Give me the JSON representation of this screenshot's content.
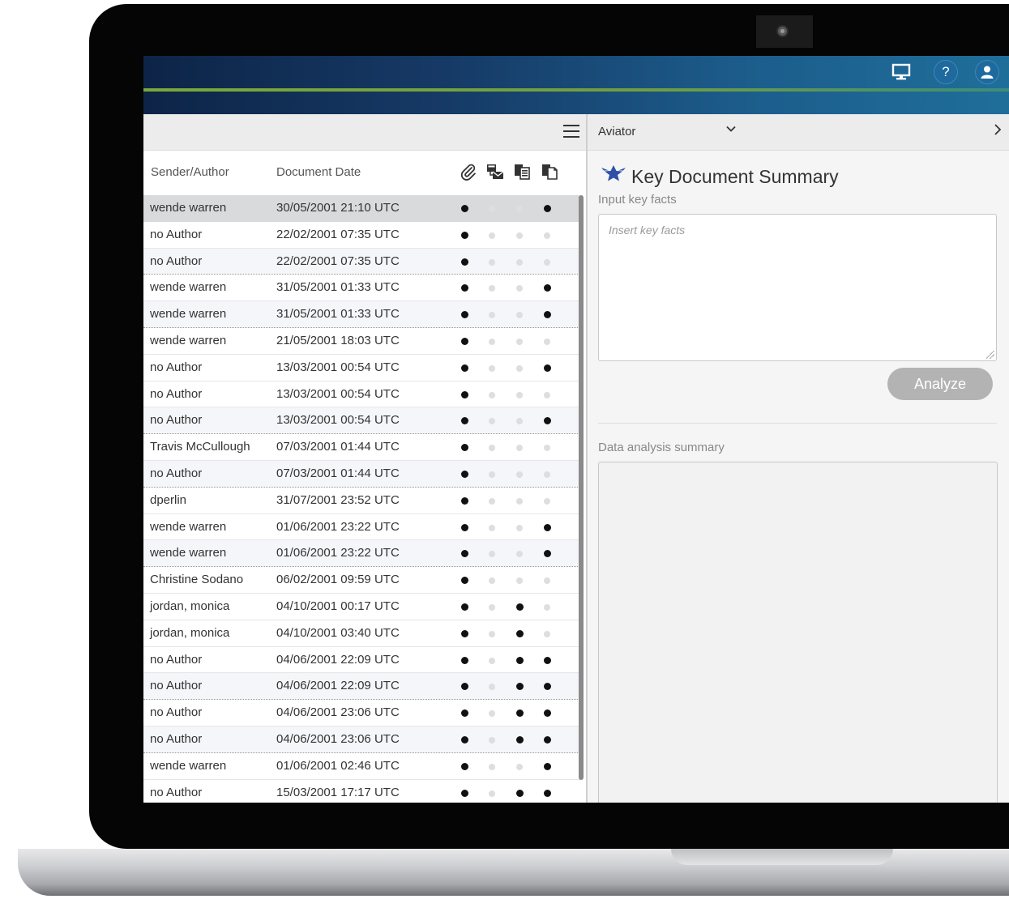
{
  "header": {
    "icons": [
      "monitor-icon",
      "help-icon",
      "user-icon"
    ],
    "help_glyph": "?"
  },
  "left_panel": {
    "columns": {
      "sender": "Sender/Author",
      "date": "Document Date",
      "icon_columns": [
        "paperclip-icon",
        "email-icon",
        "duplicate-docs-icon",
        "copy-docs-icon"
      ]
    },
    "rows": [
      {
        "sender": "wende warren",
        "date": "30/05/2001 21:10 UTC",
        "flags": [
          1,
          0,
          0,
          1
        ],
        "selected": true
      },
      {
        "sender": "no Author",
        "date": "22/02/2001 07:35 UTC",
        "flags": [
          1,
          0,
          0,
          0
        ]
      },
      {
        "sender": "no Author",
        "date": "22/02/2001 07:35 UTC",
        "flags": [
          1,
          0,
          0,
          0
        ]
      },
      {
        "sender": "wende warren",
        "date": "31/05/2001 01:33 UTC",
        "flags": [
          1,
          0,
          0,
          1
        ]
      },
      {
        "sender": "wende warren",
        "date": "31/05/2001 01:33 UTC",
        "flags": [
          1,
          0,
          0,
          1
        ]
      },
      {
        "sender": "wende warren",
        "date": "21/05/2001 18:03 UTC",
        "flags": [
          1,
          0,
          0,
          0
        ]
      },
      {
        "sender": "no Author",
        "date": "13/03/2001 00:54 UTC",
        "flags": [
          1,
          0,
          0,
          1
        ]
      },
      {
        "sender": "no Author",
        "date": "13/03/2001 00:54 UTC",
        "flags": [
          1,
          0,
          0,
          0
        ]
      },
      {
        "sender": "no Author",
        "date": "13/03/2001 00:54 UTC",
        "flags": [
          1,
          0,
          0,
          1
        ]
      },
      {
        "sender": "Travis McCullough",
        "date": "07/03/2001 01:44 UTC",
        "flags": [
          1,
          0,
          0,
          0
        ]
      },
      {
        "sender": "no Author",
        "date": "07/03/2001 01:44 UTC",
        "flags": [
          1,
          0,
          0,
          0
        ]
      },
      {
        "sender": "dperlin",
        "date": "31/07/2001 23:52 UTC",
        "flags": [
          1,
          0,
          0,
          0
        ]
      },
      {
        "sender": "wende warren",
        "date": "01/06/2001 23:22 UTC",
        "flags": [
          1,
          0,
          0,
          1
        ]
      },
      {
        "sender": "wende warren",
        "date": "01/06/2001 23:22 UTC",
        "flags": [
          1,
          0,
          0,
          1
        ]
      },
      {
        "sender": "Christine Sodano",
        "date": "06/02/2001 09:59 UTC",
        "flags": [
          1,
          0,
          0,
          0
        ]
      },
      {
        "sender": "jordan, monica",
        "date": "04/10/2001 00:17 UTC",
        "flags": [
          1,
          0,
          1,
          0
        ]
      },
      {
        "sender": "jordan, monica",
        "date": "04/10/2001 03:40 UTC",
        "flags": [
          1,
          0,
          1,
          0
        ]
      },
      {
        "sender": "no Author",
        "date": "04/06/2001 22:09 UTC",
        "flags": [
          1,
          0,
          1,
          1
        ]
      },
      {
        "sender": "no Author",
        "date": "04/06/2001 22:09 UTC",
        "flags": [
          1,
          0,
          1,
          1
        ]
      },
      {
        "sender": "no Author",
        "date": "04/06/2001 23:06 UTC",
        "flags": [
          1,
          0,
          1,
          1
        ]
      },
      {
        "sender": "no Author",
        "date": "04/06/2001 23:06 UTC",
        "flags": [
          1,
          0,
          1,
          1
        ]
      },
      {
        "sender": "wende warren",
        "date": "01/06/2001 02:46 UTC",
        "flags": [
          1,
          0,
          0,
          1
        ]
      },
      {
        "sender": "no Author",
        "date": "15/03/2001 17:17 UTC",
        "flags": [
          1,
          0,
          1,
          1
        ]
      }
    ],
    "striped_rows": [
      2,
      4,
      8,
      10,
      13,
      18,
      20
    ]
  },
  "right_panel": {
    "selector_value": "Aviator",
    "title": "Key Document Summary",
    "input_label": "Input key facts",
    "input_placeholder": "Insert key facts",
    "analyze_label": "Analyze",
    "summary_label": "Data analysis summary"
  },
  "colors": {
    "header_gradient_start": "#0d2447",
    "header_gradient_end": "#1f6e9a",
    "header_stripe": "#7aa83a",
    "accent_icon": "#2f4fa8",
    "analyze_button": "#b3b3b3"
  }
}
